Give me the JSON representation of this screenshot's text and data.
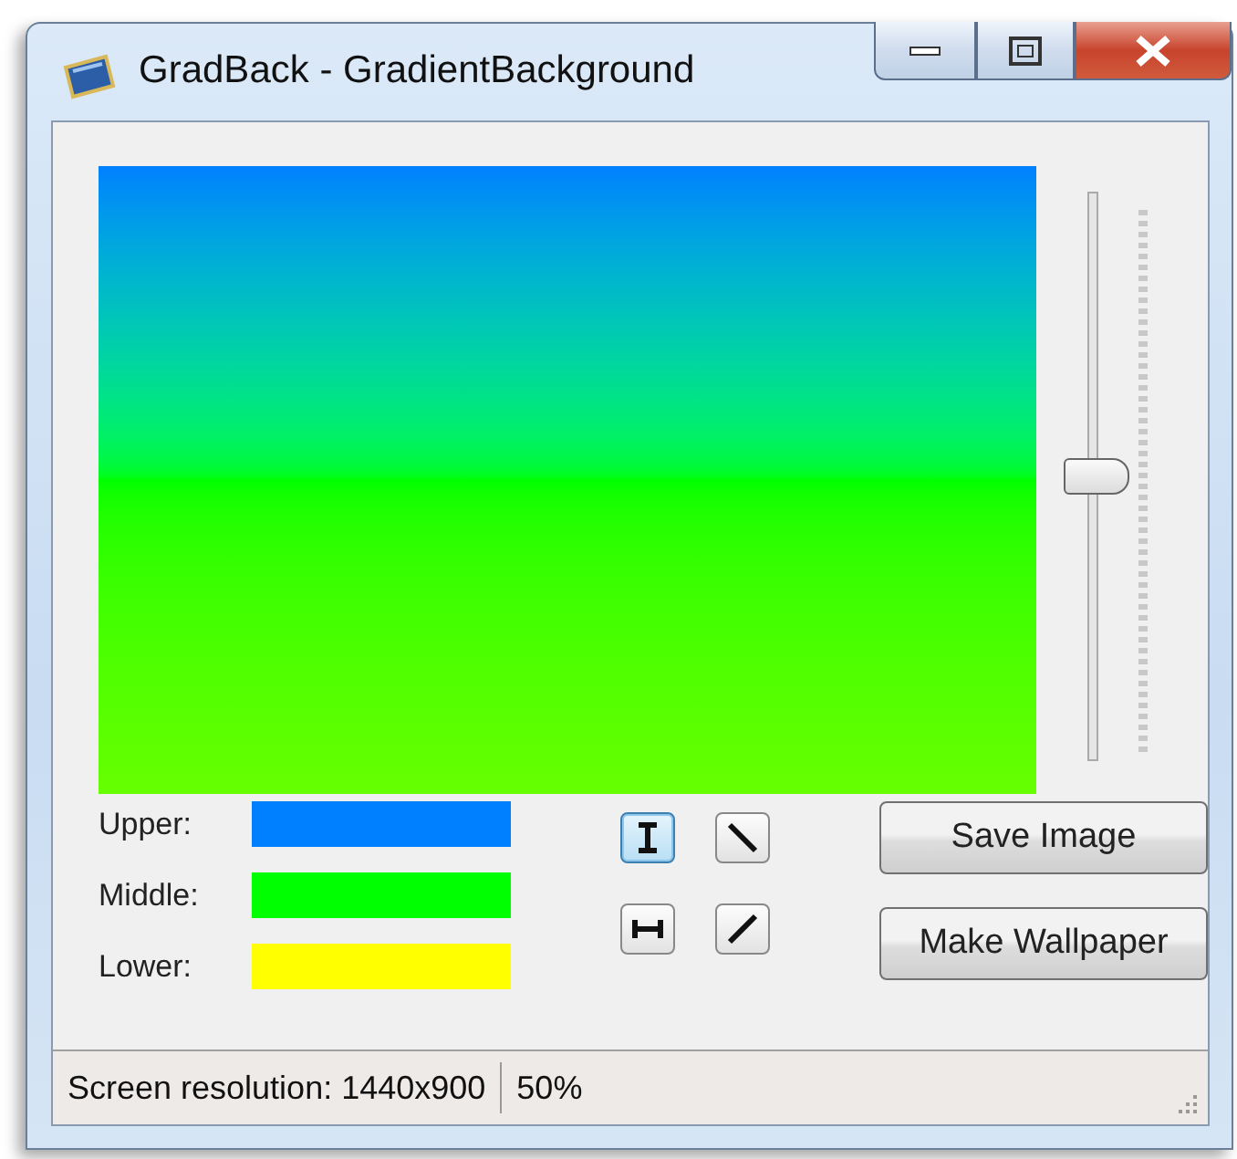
{
  "window": {
    "title": "GradBack - GradientBackground"
  },
  "preview": {
    "kind": "gradient"
  },
  "slider": {
    "level": 0.5
  },
  "colors": [
    {
      "label": "Upper:",
      "color": "#0080ff"
    },
    {
      "label": "Middle:",
      "color": "#00ff00"
    },
    {
      "label": "Lower:",
      "color": "#ffff00"
    }
  ],
  "directions": [
    {
      "kind": "vertical",
      "selected": true
    },
    {
      "kind": "diagonal-down",
      "selected": false
    },
    {
      "kind": "horizontal",
      "selected": false
    },
    {
      "kind": "diagonal-up",
      "selected": false
    }
  ],
  "buttons": [
    "Save Image",
    "Make Wallpaper"
  ],
  "status_bar": [
    "Screen resolution: 1440x900",
    "50%"
  ]
}
